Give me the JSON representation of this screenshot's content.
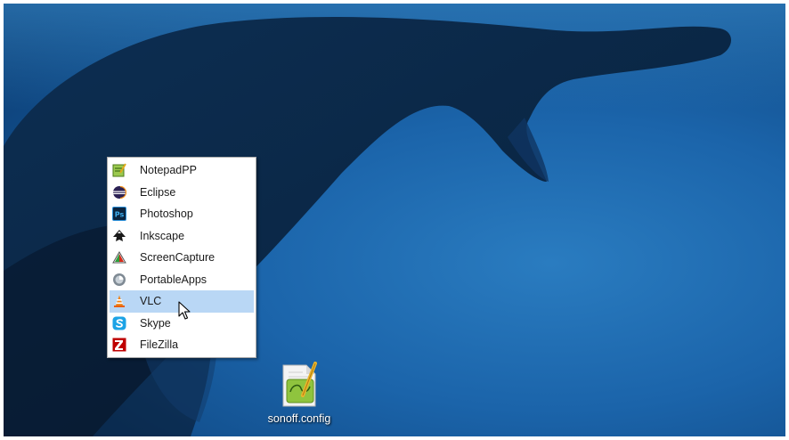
{
  "menu": {
    "items": [
      {
        "label": "NotepadPP",
        "icon": "notepadpp-icon"
      },
      {
        "label": "Eclipse",
        "icon": "eclipse-icon"
      },
      {
        "label": "Photoshop",
        "icon": "photoshop-icon"
      },
      {
        "label": "Inkscape",
        "icon": "inkscape-icon"
      },
      {
        "label": "ScreenCapture",
        "icon": "screencapture-icon"
      },
      {
        "label": "PortableApps",
        "icon": "portableapps-icon"
      },
      {
        "label": "VLC",
        "icon": "vlc-icon"
      },
      {
        "label": "Skype",
        "icon": "skype-icon"
      },
      {
        "label": "FileZilla",
        "icon": "filezilla-icon"
      }
    ],
    "highlighted": "VLC",
    "highlight_color": "#b9d7f5"
  },
  "desktop": {
    "file_label": "sonoff.config",
    "file_icon": "notepadpp-file-icon",
    "background": "whale-underwater-wallpaper"
  },
  "icons": {
    "photoshop_text": "Ps"
  }
}
